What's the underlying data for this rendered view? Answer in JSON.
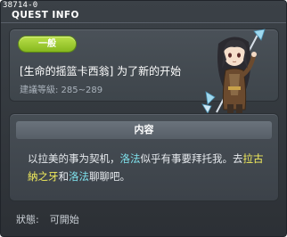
{
  "window": {
    "id_label": "38714-0",
    "title": "QUEST INFO"
  },
  "quest": {
    "category": "一般",
    "name": "[生命的摇篮卡西翁] 为了新的开始",
    "level_label": "建議等級: 285~289"
  },
  "npc": {
    "portrait_icon": "npc-portrait-icon"
  },
  "content": {
    "header": "内容",
    "segments": [
      {
        "text": "以拉美的事为契机，",
        "style": "normal"
      },
      {
        "text": "洛法",
        "style": "cyan"
      },
      {
        "text": "似乎有事要拜托我。去",
        "style": "normal"
      },
      {
        "text": "拉古納之牙",
        "style": "yellow"
      },
      {
        "text": "和",
        "style": "normal"
      },
      {
        "text": "洛法",
        "style": "cyan"
      },
      {
        "text": "聊聊吧。",
        "style": "normal"
      }
    ]
  },
  "status": {
    "label": "狀態:",
    "value": "可開始"
  },
  "colors": {
    "category_green": "#9ccb2c",
    "highlight_cyan": "#7fe3ee",
    "highlight_yellow": "#f2ec5c",
    "panel": "#3b4147"
  }
}
